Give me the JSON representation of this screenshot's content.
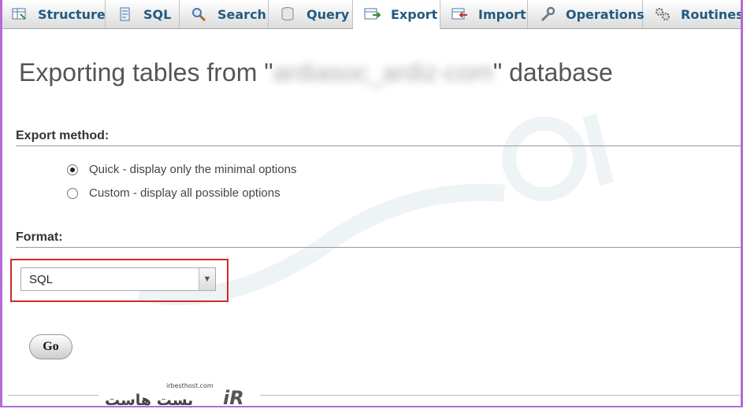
{
  "tabs": [
    {
      "label": "Structure",
      "icon": "structure-icon",
      "active": false
    },
    {
      "label": "SQL",
      "icon": "sql-icon",
      "active": false
    },
    {
      "label": "Search",
      "icon": "search-icon",
      "active": false
    },
    {
      "label": "Query",
      "icon": "query-icon",
      "active": false
    },
    {
      "label": "Export",
      "icon": "export-icon",
      "active": true
    },
    {
      "label": "Import",
      "icon": "import-icon",
      "active": false
    },
    {
      "label": "Operations",
      "icon": "wrench-icon",
      "active": false
    },
    {
      "label": "Routines",
      "icon": "gears-icon",
      "active": false
    }
  ],
  "page": {
    "title_prefix": "Exporting tables from \"",
    "db_name_blurred": "ardiasoc_ardiz-com",
    "title_suffix": "\" database"
  },
  "export_method": {
    "label": "Export method:",
    "options": [
      {
        "label": "Quick - display only the minimal options",
        "checked": true
      },
      {
        "label": "Custom - display all possible options",
        "checked": false
      }
    ]
  },
  "format": {
    "label": "Format:",
    "selected": "SQL"
  },
  "go_label": "Go",
  "watermark": {
    "url": "irbesthost.com",
    "brand": "iR"
  },
  "colors": {
    "tab_text": "#235a81",
    "highlight_border": "#d12a2a",
    "frame": "#b56ad8"
  }
}
